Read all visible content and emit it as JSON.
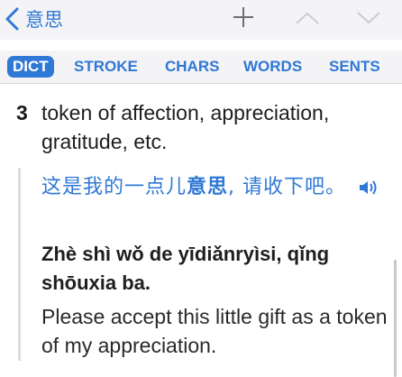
{
  "nav": {
    "back_title": "意思",
    "icons": [
      "chevron-left-icon",
      "plus-icon",
      "chevron-up-icon",
      "chevron-down-icon"
    ]
  },
  "tabs": [
    {
      "label": "DICT",
      "active": true
    },
    {
      "label": "STROKE",
      "active": false
    },
    {
      "label": "CHARS",
      "active": false
    },
    {
      "label": "WORDS",
      "active": false
    },
    {
      "label": "SENTS",
      "active": false
    }
  ],
  "entry": {
    "sense_number": "3",
    "definition": "token of affection, appreciation, gratitude, etc.",
    "example_cn_prefix": "这是我的一点儿",
    "example_cn_keyword": "意思",
    "example_cn_suffix": ", 请收下吧。",
    "example_pinyin_prefix": "Zhè shì wǒ de yīdiǎnr",
    "example_pinyin_keyword": "yìsi",
    "example_pinyin_suffix": ", qǐng shōuxia ba.",
    "example_translation": "Please accept this little gift as a token of my appreciation.",
    "audio_icon": "speaker-icon"
  },
  "colors": {
    "accent": "#2f78d6",
    "nav_bg": "#f4f4f6",
    "text": "#1e1e1e"
  }
}
